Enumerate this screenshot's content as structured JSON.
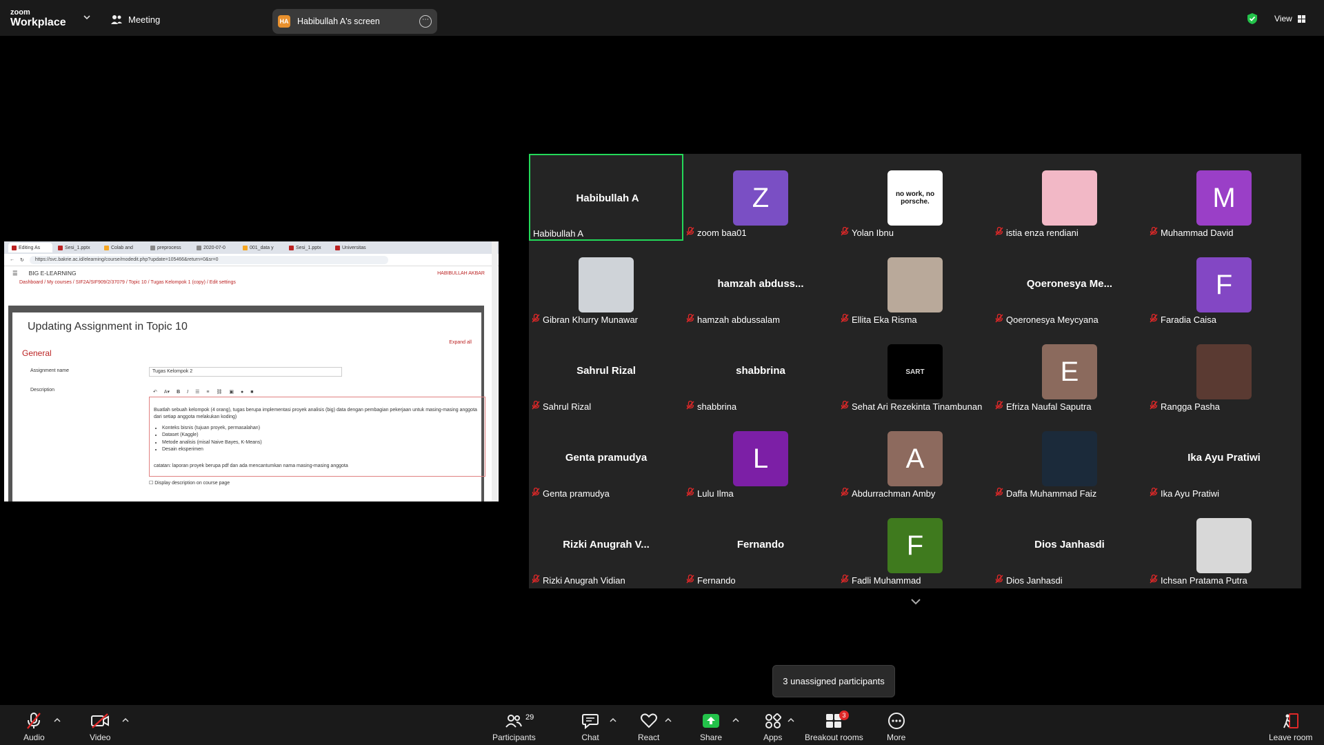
{
  "topbar": {
    "brand_small": "zoom",
    "brand_big": "Workplace",
    "meeting_label": "Meeting",
    "screen_badge": "HA",
    "screen_title": "Habibullah A's screen",
    "view_label": "View"
  },
  "shared_screen": {
    "tabs": [
      "Editing As",
      "Sesi_1.pptx",
      "Colab and",
      "preprocess",
      "2020-07-0",
      "001_data y",
      "Sesi_1.pptx",
      "Universitas"
    ],
    "url": "https://svc.bakrie.ac.id/elearning/course/modedit.php?update=105466&return=0&sr=0",
    "site_name": "BIG E-LEARNING",
    "user_name": "HABIBULLAH AKBAR",
    "breadcrumb": "Dashboard / My courses / SIF2A/SIF909/2/37079 / Topic 10 / Tugas Kelompok 1 (copy) / Edit settings",
    "page_title": "Updating Assignment in Topic 10",
    "expand_all": "Expand all",
    "section_general": "General",
    "assignment_name_label": "Assignment name",
    "assignment_name_value": "Tugas Kelompok 2",
    "description_label": "Description",
    "desc_line1": "Buatlah sebuah kelompok (4 orang), tugas berupa implementasi proyek analisis (big) data dengan pembagian pekerjaan untuk masing-masing anggota dari setiap anggota melakukan koding)",
    "bullets": [
      "Konteks bisnis (tujuan proyek, permasalahan)",
      "Dataset (Kaggle)",
      "Metode analisis (misal Naive Bayes, K-Means)",
      "Desain eksperimen"
    ],
    "desc_note": "catatan: laporan proyek berupa pdf dan ada mencantumkan nama masing-masing anggota",
    "display_desc_label": "Display description on course page"
  },
  "participants": [
    {
      "display": "Habibullah A",
      "label": "Habibullah A",
      "type": "name",
      "active": true,
      "muted": false
    },
    {
      "display": "Z",
      "label": "zoom baa01",
      "type": "letter",
      "color": "#7a4fc4",
      "muted": true
    },
    {
      "display": "no work, no porsche.",
      "label": "Yolan Ibnu",
      "type": "text-img",
      "color": "#ffffff",
      "muted": true
    },
    {
      "display": "",
      "label": "istia enza rendiani",
      "type": "photo",
      "color": "#f2b8c6",
      "muted": true
    },
    {
      "display": "M",
      "label": "Muhammad David",
      "type": "letter",
      "color": "#9a3fc7",
      "muted": true
    },
    {
      "display": "",
      "label": "Gibran Khurry Munawar",
      "type": "photo",
      "color": "#cfd3d8",
      "muted": true
    },
    {
      "display": "hamzah abduss...",
      "label": "hamzah abdussalam",
      "type": "name",
      "muted": true
    },
    {
      "display": "",
      "label": "Ellita Eka Risma",
      "type": "photo",
      "color": "#b9a99a",
      "muted": true
    },
    {
      "display": "Qoeronesya Me...",
      "label": "Qoeronesya Meycyana",
      "type": "name",
      "muted": true
    },
    {
      "display": "F",
      "label": "Faradia Caisa",
      "type": "letter",
      "color": "#8347c4",
      "muted": true
    },
    {
      "display": "Sahrul Rizal",
      "label": "Sahrul Rizal",
      "type": "name",
      "muted": true
    },
    {
      "display": "shabbrina",
      "label": "shabbrina",
      "type": "name",
      "muted": true
    },
    {
      "display": "SART",
      "label": "Sehat Ari Rezekinta Tinambunan",
      "type": "text-img",
      "color": "#000000",
      "muted": true
    },
    {
      "display": "E",
      "label": "Efriza Naufal Saputra",
      "type": "letter",
      "color": "#8b6a5d",
      "muted": true
    },
    {
      "display": "",
      "label": "Rangga Pasha",
      "type": "photo",
      "color": "#5a3a32",
      "muted": true
    },
    {
      "display": "Genta pramudya",
      "label": "Genta pramudya",
      "type": "name",
      "muted": true
    },
    {
      "display": "L",
      "label": "Lulu Ilma",
      "type": "letter",
      "color": "#7c1fa6",
      "muted": true
    },
    {
      "display": "A",
      "label": "Abdurrachman Amby",
      "type": "letter",
      "color": "#8d6a5e",
      "muted": true
    },
    {
      "display": "",
      "label": "Daffa Muhammad Faiz",
      "type": "photo",
      "color": "#1b2a3a",
      "muted": true
    },
    {
      "display": "Ika Ayu Pratiwi",
      "label": "Ika Ayu Pratiwi",
      "type": "name",
      "muted": true
    },
    {
      "display": "Rizki Anugrah V...",
      "label": "Rizki Anugrah Vidian",
      "type": "name",
      "muted": true
    },
    {
      "display": "Fernando",
      "label": "Fernando",
      "type": "name",
      "muted": true
    },
    {
      "display": "F",
      "label": "Fadli Muhammad",
      "type": "letter",
      "color": "#3f7a1e",
      "muted": true
    },
    {
      "display": "Dios Janhasdi",
      "label": "Dios Janhasdi",
      "type": "name",
      "muted": true
    },
    {
      "display": "",
      "label": "Ichsan Pratama Putra",
      "type": "photo",
      "color": "#d8d8d8",
      "muted": true
    }
  ],
  "tooltip": "3 unassigned participants",
  "toolbar": {
    "audio": "Audio",
    "video": "Video",
    "participants": "Participants",
    "participants_count": "29",
    "chat": "Chat",
    "react": "React",
    "share": "Share",
    "apps": "Apps",
    "breakout": "Breakout rooms",
    "breakout_badge": "3",
    "more": "More",
    "leave": "Leave room"
  },
  "colors": {
    "active_border": "#23d959",
    "muted_red": "#e02828",
    "share_green": "#23c24a",
    "shield_green": "#23c24a"
  }
}
